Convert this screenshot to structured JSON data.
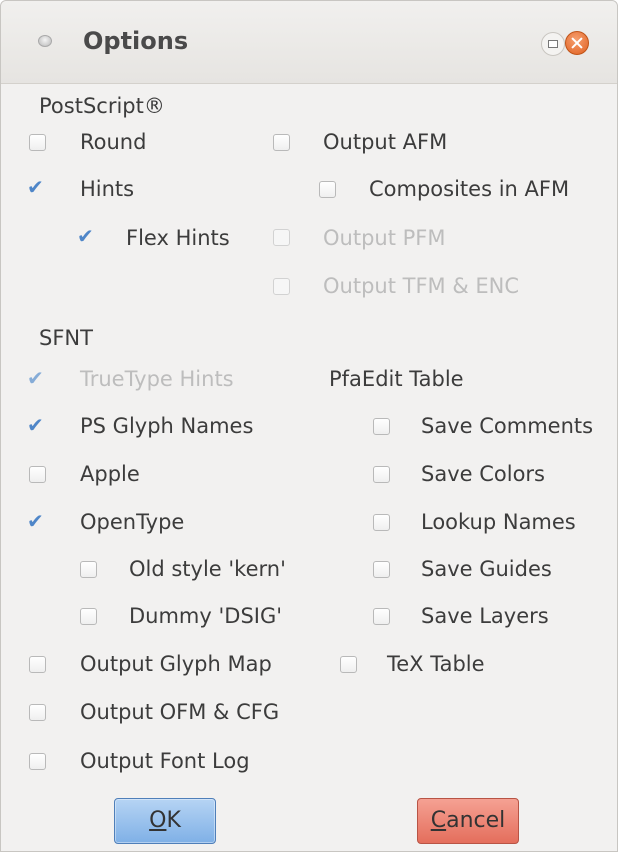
{
  "window": {
    "title": "Options"
  },
  "sections": {
    "postscript": "PostScript®",
    "sfnt": "SFNT",
    "pfaedit": "PfaEdit Table"
  },
  "options": {
    "round": {
      "label": "Round",
      "checked": false,
      "enabled": true
    },
    "output_afm": {
      "label": "Output AFM",
      "checked": false,
      "enabled": true
    },
    "hints": {
      "label": "Hints",
      "checked": true,
      "enabled": true
    },
    "composites_in_afm": {
      "label": "Composites in AFM",
      "checked": false,
      "enabled": true
    },
    "flex_hints": {
      "label": "Flex Hints",
      "checked": true,
      "enabled": true
    },
    "output_pfm": {
      "label": "Output PFM",
      "checked": false,
      "enabled": false
    },
    "output_tfm_enc": {
      "label": "Output TFM & ENC",
      "checked": false,
      "enabled": false
    },
    "truetype_hints": {
      "label": "TrueType Hints",
      "checked": true,
      "enabled": false
    },
    "ps_glyph_names": {
      "label": "PS Glyph Names",
      "checked": true,
      "enabled": true
    },
    "save_comments": {
      "label": "Save Comments",
      "checked": false,
      "enabled": true
    },
    "apple": {
      "label": "Apple",
      "checked": false,
      "enabled": true
    },
    "save_colors": {
      "label": "Save Colors",
      "checked": false,
      "enabled": true
    },
    "opentype": {
      "label": "OpenType",
      "checked": true,
      "enabled": true
    },
    "lookup_names": {
      "label": "Lookup Names",
      "checked": false,
      "enabled": true
    },
    "old_style_kern": {
      "label": "Old style 'kern'",
      "checked": false,
      "enabled": true
    },
    "save_guides": {
      "label": "Save Guides",
      "checked": false,
      "enabled": true
    },
    "dummy_dsig": {
      "label": "Dummy 'DSIG'",
      "checked": false,
      "enabled": true
    },
    "save_layers": {
      "label": "Save Layers",
      "checked": false,
      "enabled": true
    },
    "output_glyph_map": {
      "label": "Output Glyph Map",
      "checked": false,
      "enabled": true
    },
    "tex_table": {
      "label": "TeX Table",
      "checked": false,
      "enabled": true
    },
    "output_ofm_cfg": {
      "label": "Output OFM & CFG",
      "checked": false,
      "enabled": true
    },
    "output_font_log": {
      "label": "Output Font Log",
      "checked": false,
      "enabled": true
    }
  },
  "buttons": {
    "ok": {
      "mnemonic": "O",
      "rest": "K"
    },
    "cancel": {
      "mnemonic": "C",
      "rest": "ancel"
    }
  },
  "colors": {
    "check_mark": "#4f86c8",
    "ok_button": "#7fb0e6",
    "cancel_button": "#e46e5c"
  }
}
